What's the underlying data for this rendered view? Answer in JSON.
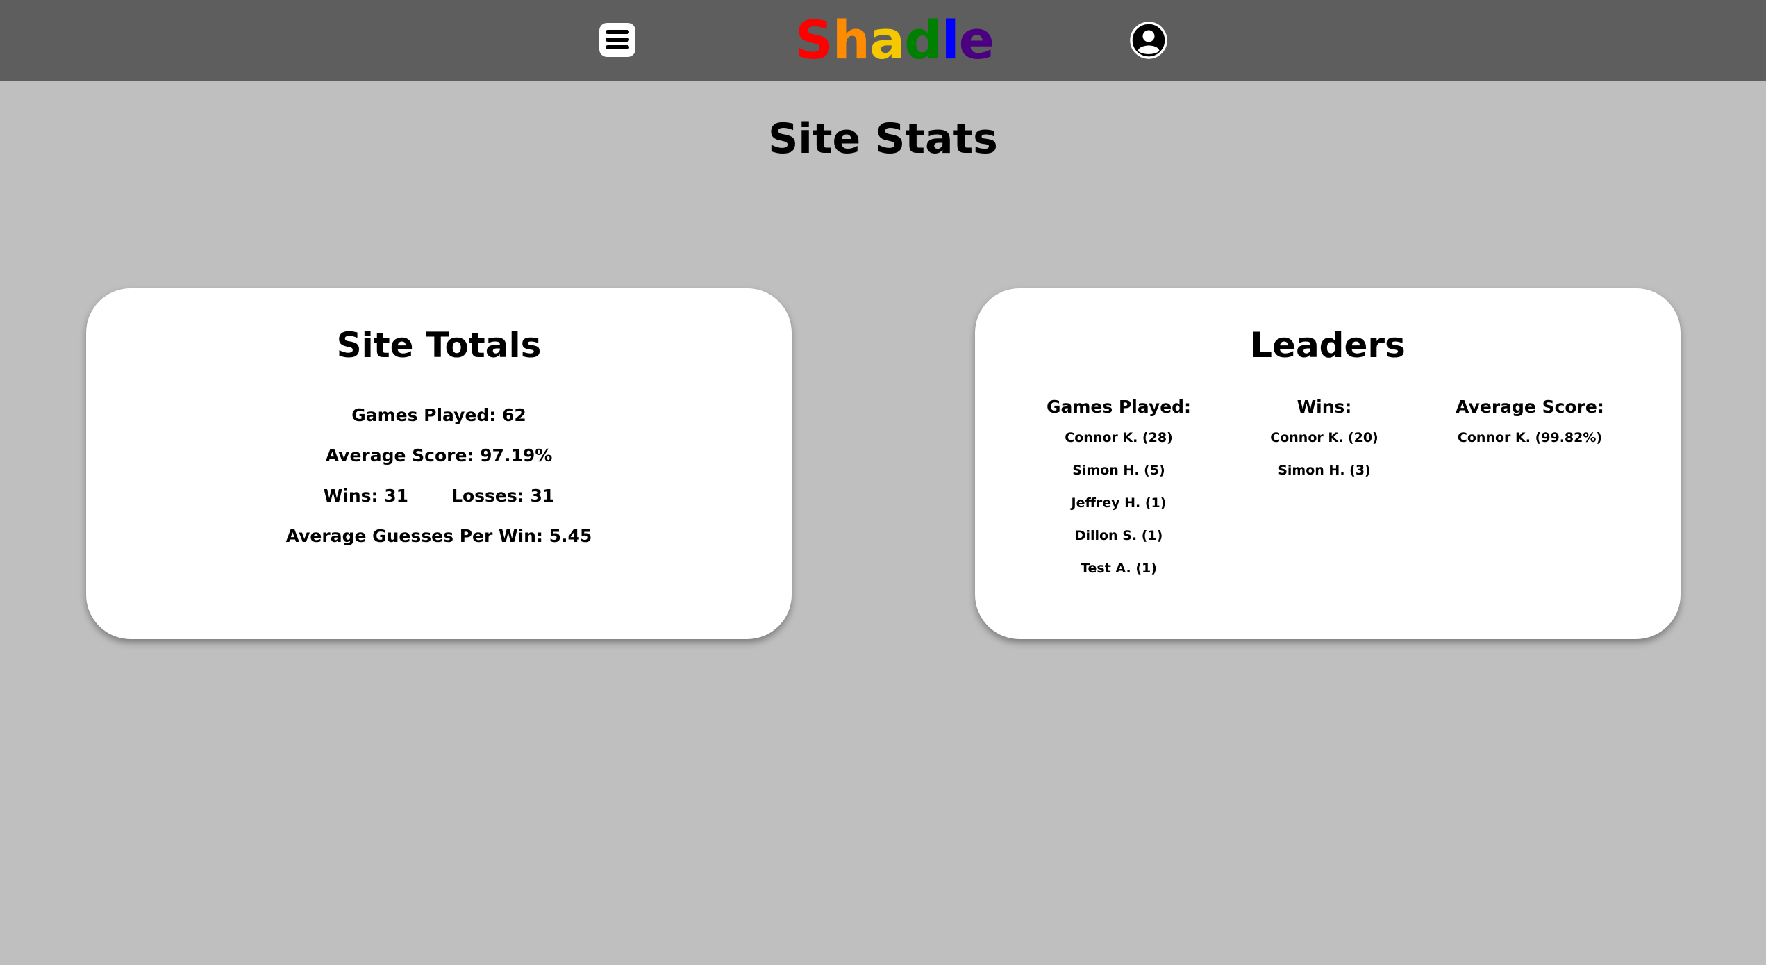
{
  "header": {
    "logo_letters": [
      {
        "char": "S",
        "color": "#ff0000"
      },
      {
        "char": "h",
        "color": "#ff8c00"
      },
      {
        "char": "a",
        "color": "#f5c800"
      },
      {
        "char": "d",
        "color": "#008000"
      },
      {
        "char": "l",
        "color": "#0000ff"
      },
      {
        "char": "e",
        "color": "#4b0082"
      }
    ],
    "menu_icon": "hamburger-menu-icon",
    "profile_icon": "user-circle-icon"
  },
  "page": {
    "title": "Site Stats"
  },
  "totals": {
    "title": "Site Totals",
    "games_played": "Games Played: 62",
    "average_score": "Average Score: 97.19%",
    "wins": "Wins: 31",
    "losses": "Losses: 31",
    "avg_guesses": "Average Guesses Per Win: 5.45"
  },
  "leaders": {
    "title": "Leaders",
    "columns": [
      {
        "heading": "Games Played:",
        "entries": [
          "Connor K. (28)",
          "Simon H. (5)",
          "Jeffrey H. (1)",
          "Dillon S. (1)",
          "Test A. (1)"
        ]
      },
      {
        "heading": "Wins:",
        "entries": [
          "Connor K. (20)",
          "Simon H. (3)"
        ]
      },
      {
        "heading": "Average Score:",
        "entries": [
          "Connor K. (99.82%)"
        ]
      }
    ]
  },
  "colors": {
    "topbar": "#5e5e5e",
    "background": "#bfbfbf",
    "card": "#ffffff"
  }
}
